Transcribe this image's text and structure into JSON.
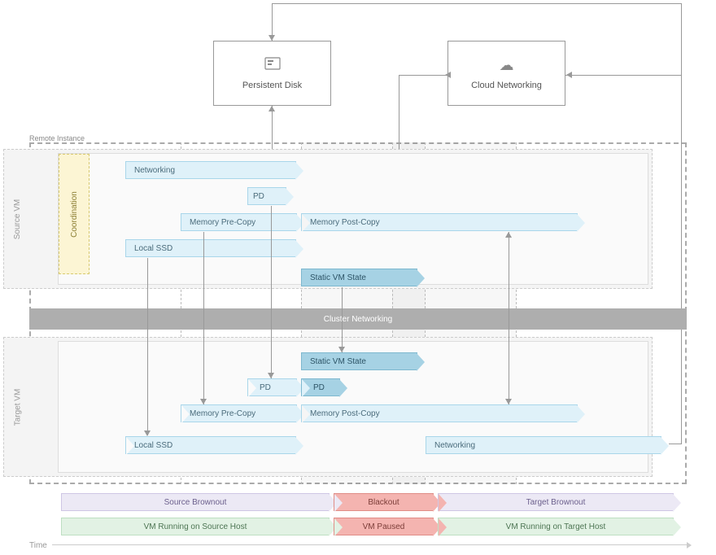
{
  "top": {
    "persistent_disk": "Persistent Disk",
    "cloud_networking": "Cloud Networking"
  },
  "container": {
    "remote_instance": "Remote Instance",
    "source_vm": "Source VM",
    "target_vm": "Target VM",
    "coordination": "Coordination",
    "cluster_networking": "Cluster Networking"
  },
  "bands": {
    "networking": "Networking",
    "pd": "PD",
    "memory_pre_copy": "Memory Pre-Copy",
    "memory_post_copy": "Memory Post-Copy",
    "local_ssd": "Local SSD",
    "static_vm_state": "Static VM State"
  },
  "phases": {
    "source_brownout": "Source Brownout",
    "blackout": "Blackout",
    "target_brownout": "Target Brownout",
    "vm_running_source": "VM Running on Source Host",
    "vm_paused": "VM Paused",
    "vm_running_target": "VM Running on Target Host"
  },
  "axis_label": "Time"
}
